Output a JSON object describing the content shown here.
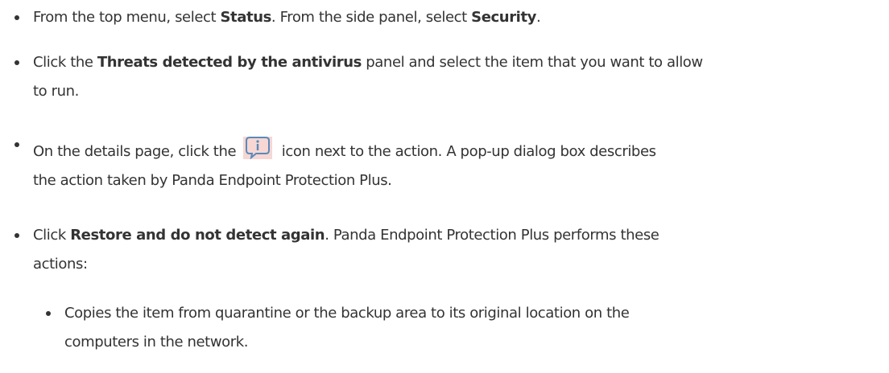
{
  "steps": [
    {
      "parts": [
        "From the top menu, select ",
        "Status",
        ". From the side panel, select ",
        "Security",
        "."
      ]
    },
    {
      "parts": [
        "Click the ",
        "Threats detected by the antivirus",
        " panel and select the item that you want to allow",
        "to run."
      ]
    },
    {
      "parts": [
        "On the details page, click the ",
        " icon next to the action. A pop-up dialog box describes",
        "the action taken by Panda Endpoint Protection Plus."
      ],
      "icon": "info-icon"
    },
    {
      "parts": [
        "Click ",
        "Restore and do not detect again",
        ". Panda Endpoint Protection Plus performs these",
        "actions:"
      ]
    }
  ],
  "substeps": [
    {
      "parts": [
        "Copies the item from quarantine or the backup area to its original location on the",
        "computers in the network."
      ]
    }
  ]
}
